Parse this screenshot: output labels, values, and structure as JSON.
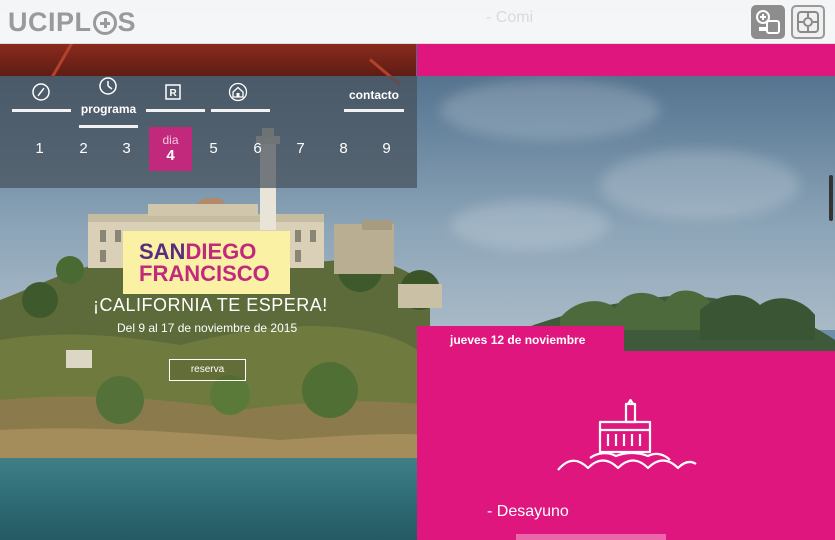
{
  "header": {
    "logo": {
      "left": "UCIPL",
      "right": "S"
    },
    "ghost_text": "- Comi",
    "icons": {
      "accessibility": "accessibility-icon",
      "settings": "gear-icon"
    }
  },
  "nav": {
    "tabs": [
      {
        "id": "info",
        "icon": "compass-icon",
        "label": ""
      },
      {
        "id": "programa",
        "icon": "clock-icon",
        "label": "programa"
      },
      {
        "id": "reserva",
        "icon": "r-icon",
        "label": ""
      },
      {
        "id": "alojamiento",
        "icon": "house-icon",
        "label": ""
      },
      {
        "id": "contacto",
        "icon": "",
        "label": "contacto"
      }
    ],
    "days": {
      "word": "dia",
      "items": [
        "1",
        "2",
        "3",
        "4",
        "5",
        "6",
        "7",
        "8",
        "9"
      ],
      "active": "4"
    }
  },
  "promo": {
    "line1_a": "SAN",
    "line1_b": "DIEGO",
    "line2": "FRANCISCO",
    "tagline": "¡CALIFORNIA TE ESPERA!",
    "dates": "Del 9 al 17 de noviembre de 2015",
    "button": "reserva"
  },
  "schedule": {
    "date_label": "jueves 12 de noviembre",
    "icon": "alcatraz-island-icon",
    "item": "- Desayuno"
  },
  "colors": {
    "accent": "#e0167f",
    "active_day": "#c2297d",
    "promo_purple": "#5a2c7e",
    "promo_bg": "#fbf1a5"
  }
}
